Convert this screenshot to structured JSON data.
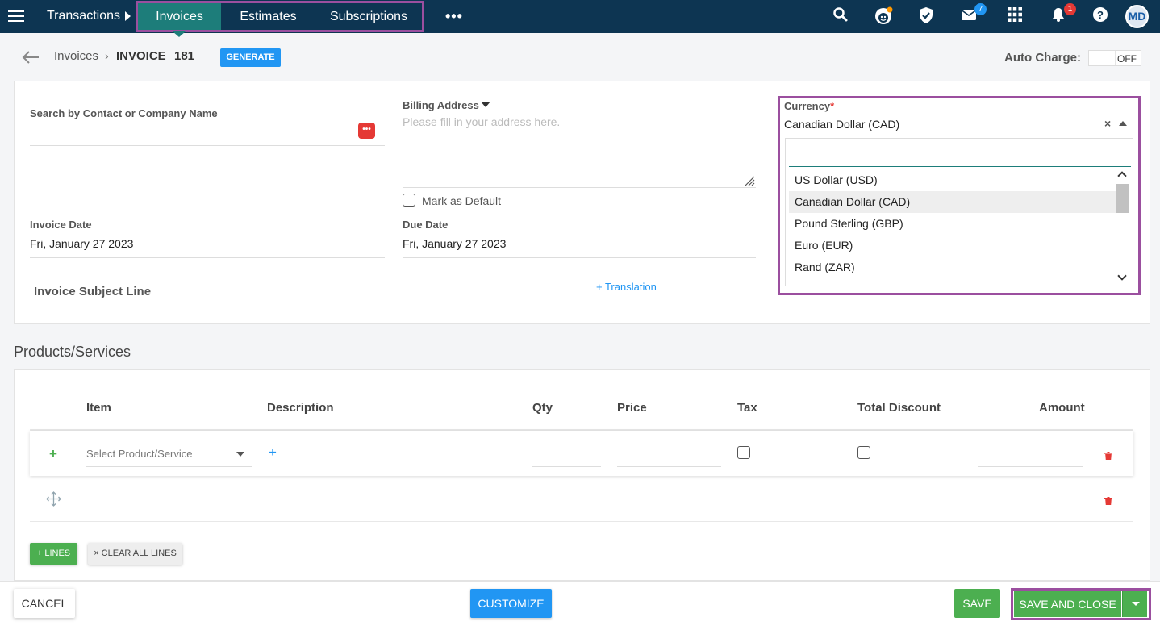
{
  "nav": {
    "section": "Transactions",
    "tabs": [
      {
        "label": "Invoices",
        "active": true
      },
      {
        "label": "Estimates",
        "active": false
      },
      {
        "label": "Subscriptions",
        "active": false
      }
    ],
    "more": "•••",
    "mail_badge": "7",
    "notif_badge": "1",
    "avatar": "MD",
    "colors": {
      "bar": "#0d3552",
      "active_tab": "#1d7d7a",
      "highlight": "#9b4f9f"
    }
  },
  "header": {
    "breadcrumb_parent": "Invoices",
    "separator": "›",
    "title": "INVOICE",
    "number": "181",
    "generate_label": "GENERATE",
    "auto_charge_label": "Auto Charge:",
    "toggle_state": "OFF"
  },
  "form": {
    "contact_label": "Search by Contact or Company Name",
    "billing_label": "Billing Address",
    "billing_placeholder": "Please fill in your address here.",
    "mark_default_label": "Mark as Default",
    "invoice_date_label": "Invoice Date",
    "invoice_date": "Fri, January 27 2023",
    "due_date_label": "Due Date",
    "due_date": "Fri, January 27 2023",
    "subject_label": "Invoice Subject Line",
    "translation_link": "+ Translation",
    "currency_label": "Currency",
    "currency_required": "*",
    "currency_value": "Canadian Dollar (CAD)",
    "currency_clear": "×",
    "currency_options": [
      "US Dollar (USD)",
      "Canadian Dollar (CAD)",
      "Pound Sterling (GBP)",
      "Euro (EUR)",
      "Rand (ZAR)"
    ]
  },
  "products": {
    "title": "Products/Services",
    "columns": {
      "item": "Item",
      "description": "Description",
      "qty": "Qty",
      "price": "Price",
      "tax": "Tax",
      "total_discount": "Total Discount",
      "amount": "Amount"
    },
    "add_row": "+",
    "add_description": "+",
    "select_placeholder": "Select Product/Service",
    "lines_button": "+  LINES",
    "clear_button": "×  CLEAR ALL LINES"
  },
  "footer": {
    "cancel": "CANCEL",
    "customize": "CUSTOMIZE",
    "save": "SAVE",
    "save_and_close": "SAVE AND CLOSE"
  }
}
